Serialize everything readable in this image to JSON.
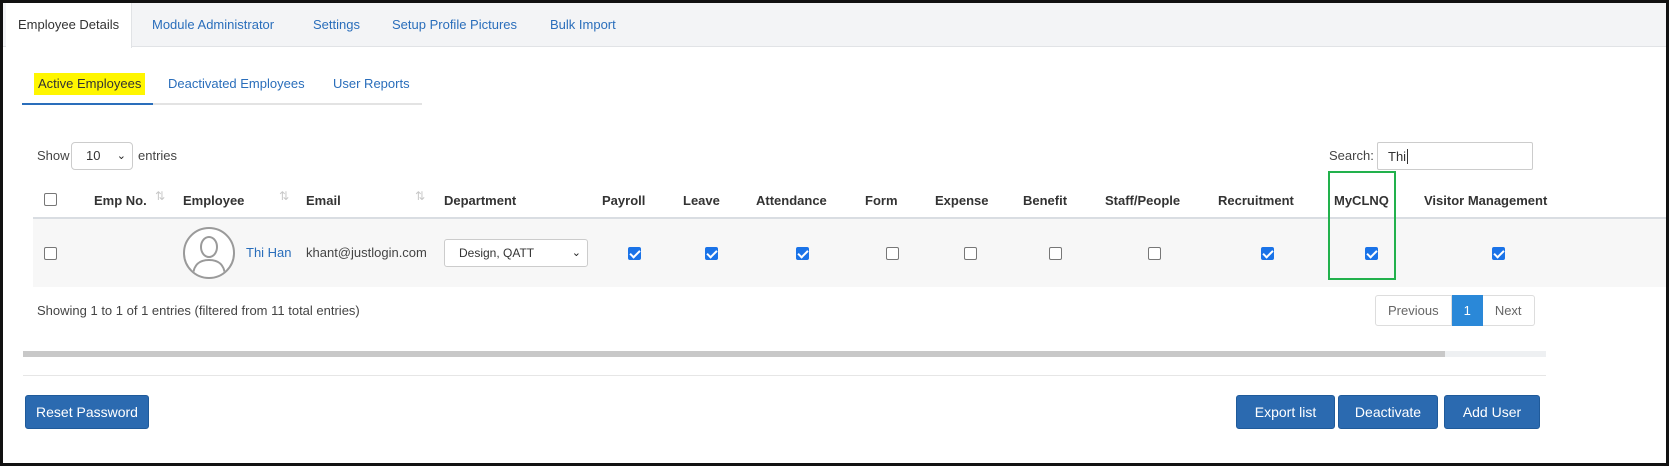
{
  "top_tabs": [
    {
      "label": "Employee Details",
      "active": true
    },
    {
      "label": "Module Administrator"
    },
    {
      "label": "Settings"
    },
    {
      "label": "Setup Profile Pictures"
    },
    {
      "label": "Bulk Import"
    }
  ],
  "sub_tabs": [
    {
      "label": "Active Employees",
      "active": true
    },
    {
      "label": "Deactivated Employees"
    },
    {
      "label": "User Reports"
    }
  ],
  "show": {
    "prefix": "Show",
    "value": "10",
    "suffix": "entries"
  },
  "search": {
    "label": "Search:",
    "value": "Thi"
  },
  "columns": [
    "Emp No.",
    "Employee",
    "Email",
    "Department",
    "Payroll",
    "Leave",
    "Attendance",
    "Form",
    "Expense",
    "Benefit",
    "Staff/People",
    "Recruitment",
    "MyCLNQ",
    "Visitor Management"
  ],
  "rows": [
    {
      "emp_no": "",
      "employee": "Thi Han",
      "email": "khant@justlogin.com",
      "department": "Design, QATT",
      "modules": {
        "payroll": true,
        "leave": true,
        "attendance": true,
        "form": false,
        "expense": false,
        "benefit": false,
        "staff_people": false,
        "recruitment": true,
        "myclnq": true,
        "visitor_management": true
      }
    }
  ],
  "info": "Showing 1 to 1 of 1 entries (filtered from 11 total entries)",
  "pagination": {
    "previous": "Previous",
    "current": "1",
    "next": "Next"
  },
  "buttons": {
    "reset_password": "Reset Password",
    "export_list": "Export list",
    "deactivate": "Deactivate",
    "add_user": "Add User"
  },
  "colors": {
    "highlight_yellow": "#fff600",
    "highlight_green": "#22b14c",
    "primary": "#2b6ab0"
  }
}
